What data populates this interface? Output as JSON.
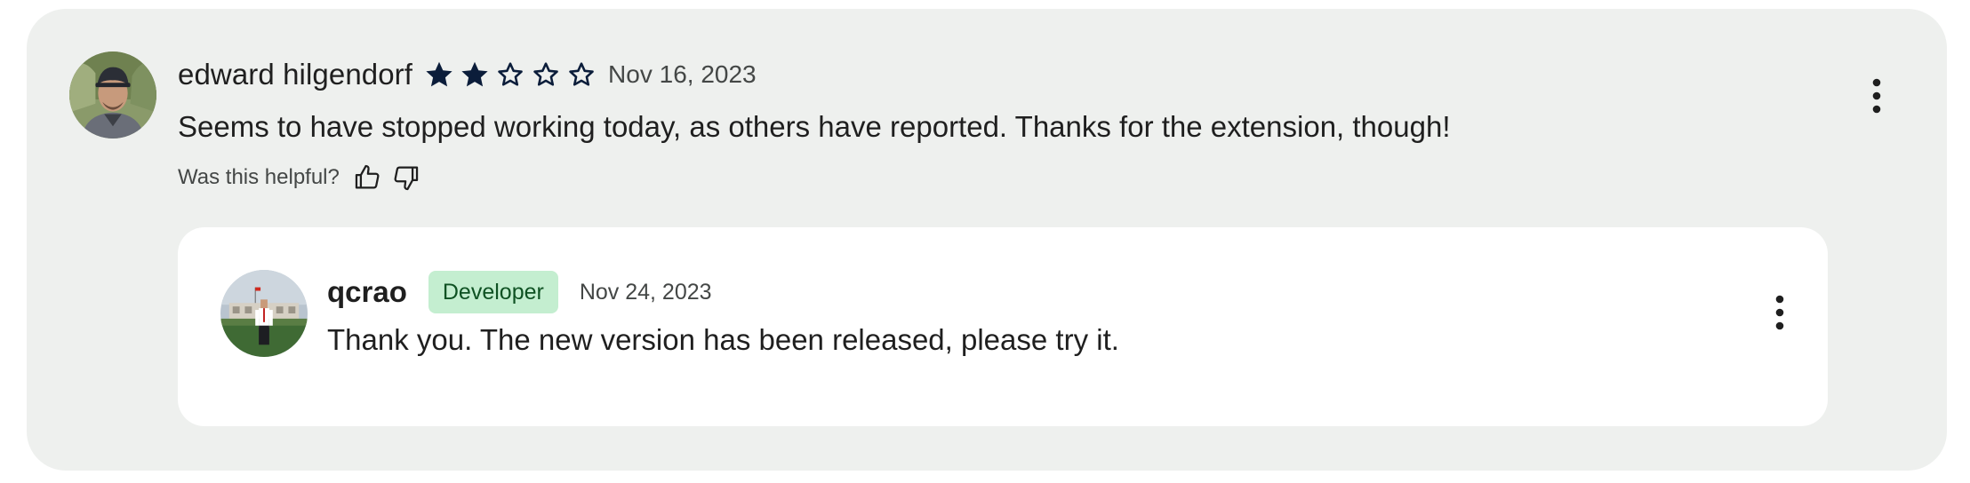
{
  "review": {
    "reviewer_name": "edward hilgendorf",
    "rating": 2,
    "max_rating": 5,
    "date": "Nov 16, 2023",
    "text": "Seems to have stopped working today, as others have reported. Thanks for the extension, though!",
    "helpful_label": "Was this helpful?",
    "icons": {
      "avatar": "user-avatar",
      "thumb_up": "thumb-up-icon",
      "thumb_down": "thumb-down-icon",
      "more": "more-vertical-icon"
    }
  },
  "reply": {
    "developer_name": "qcrao",
    "badge": "Developer",
    "date": "Nov 24, 2023",
    "text": "Thank you. The new version has been released, please try it.",
    "icons": {
      "avatar": "developer-avatar",
      "more": "more-vertical-icon"
    }
  },
  "colors": {
    "card_background": "#eef0ee",
    "reply_background": "#ffffff",
    "star_color": "#0b1d3a",
    "badge_background": "#c4eed0",
    "badge_text": "#0f5223"
  }
}
